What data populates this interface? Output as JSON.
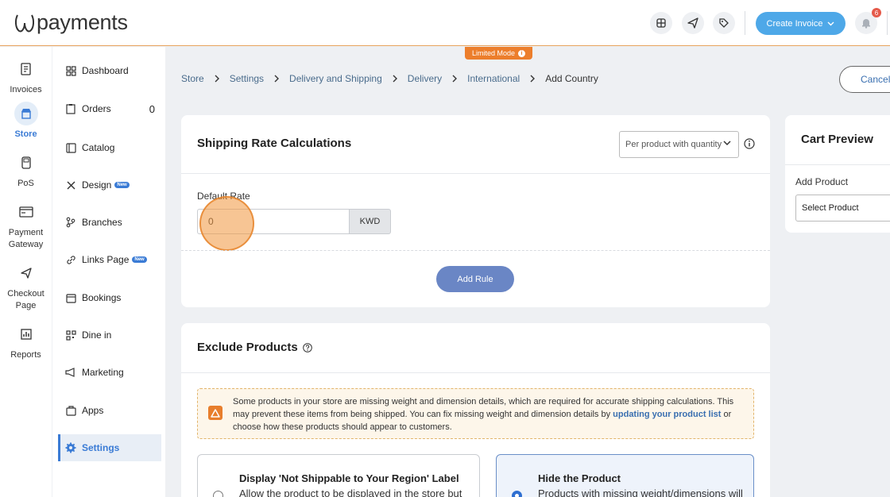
{
  "app": {
    "logo_text": "payments"
  },
  "header": {
    "create_invoice_label": "Create Invoice",
    "notification_count": "6",
    "limited_mode_label": "Limited Mode"
  },
  "rail": {
    "items": [
      {
        "label": "Invoices",
        "icon": "invoice-icon"
      },
      {
        "label": "Store",
        "icon": "store-icon",
        "active": true
      },
      {
        "label": "PoS",
        "icon": "pos-icon"
      },
      {
        "label": "Payment Gateway",
        "icon": "payment-gateway-icon"
      },
      {
        "label": "Checkout Page",
        "icon": "checkout-page-icon"
      },
      {
        "label": "Reports",
        "icon": "reports-icon"
      }
    ]
  },
  "subnav": {
    "items": [
      {
        "label": "Dashboard"
      },
      {
        "label": "Orders",
        "count": "0"
      },
      {
        "label": "Catalog"
      },
      {
        "label": "Design",
        "badge": "New"
      },
      {
        "label": "Branches"
      },
      {
        "label": "Links Page",
        "badge": "New"
      },
      {
        "label": "Bookings"
      },
      {
        "label": "Dine in"
      },
      {
        "label": "Marketing"
      },
      {
        "label": "Apps"
      },
      {
        "label": "Settings",
        "active": true
      }
    ]
  },
  "breadcrumb": [
    "Store",
    "Settings",
    "Delivery and Shipping",
    "Delivery",
    "International",
    "Add Country"
  ],
  "cancel_label": "Cancel",
  "shipping": {
    "title": "Shipping Rate Calculations",
    "mode_selected": "Per product with quantity",
    "default_rate_label": "Default Rate",
    "default_rate_value": "0",
    "currency": "KWD",
    "add_rule_label": "Add Rule"
  },
  "exclude": {
    "title": "Exclude Products",
    "warning_text_1": "Some products in your store are missing weight and dimension details, which are required for accurate shipping calculations. This may prevent these items from being shipped. You can fix missing weight and dimension details by ",
    "warning_link": "updating your product list",
    "warning_text_2": " or choose how these products should appear to customers.",
    "options": [
      {
        "title": "Display 'Not Shippable to Your Region' Label",
        "desc": "Allow the product to be displayed in the store but",
        "selected": false
      },
      {
        "title": "Hide the Product",
        "desc": "Products with missing weight/dimensions will",
        "selected": true
      }
    ]
  },
  "cart_preview": {
    "title": "Cart Preview",
    "add_product_label": "Add Product",
    "select_product_label": "Select Product"
  },
  "colors": {
    "primary": "#4ea8e8",
    "accent_blue": "#3a7bd5",
    "limited_orange": "#ec7e2c",
    "add_rule_button": "#6a86c5"
  }
}
